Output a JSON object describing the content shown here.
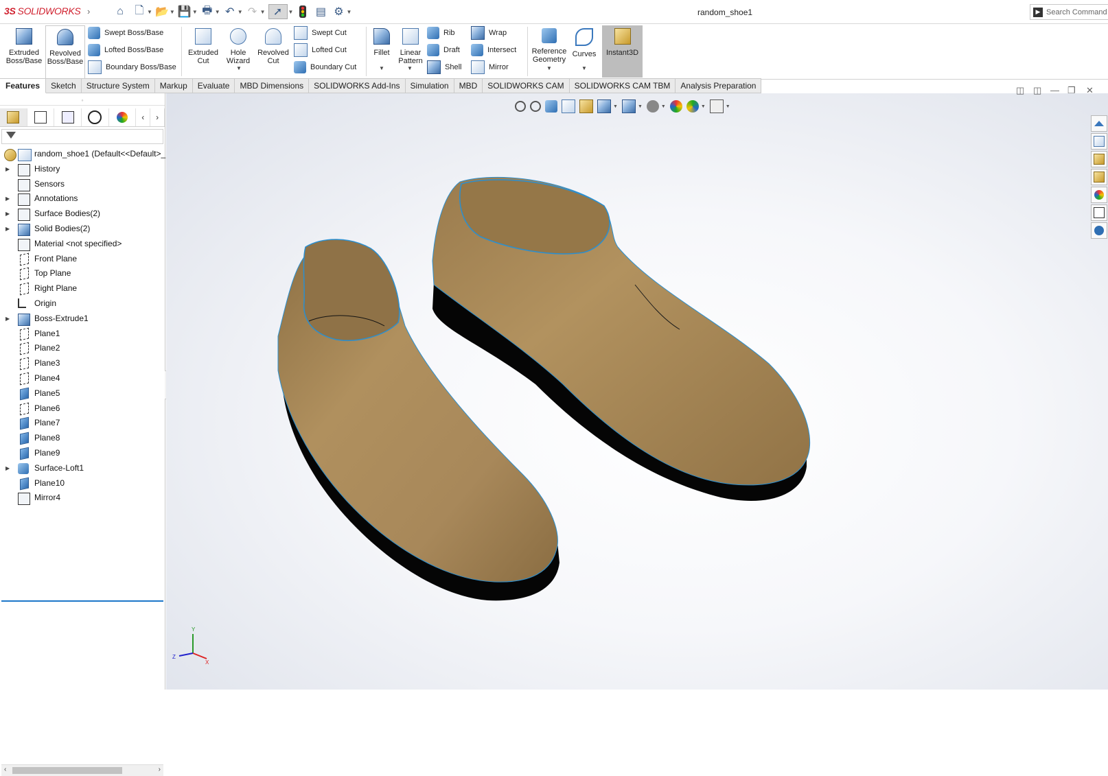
{
  "app": {
    "logo_ds": "3S",
    "logo_text": "SOLIDWORKS",
    "document_title": "random_shoe1",
    "search_placeholder": "Search Command"
  },
  "quick_access": [
    "home-icon",
    "new-document-icon",
    "open-icon",
    "save-icon",
    "print-icon",
    "undo-icon",
    "redo-icon",
    "select-icon",
    "rebuild-icon",
    "file-properties-icon",
    "options-icon"
  ],
  "ribbon": {
    "extruded_boss": "Extruded Boss/Base",
    "revolved_boss": "Revolved Boss/Base",
    "swept_boss": "Swept Boss/Base",
    "lofted_boss": "Lofted Boss/Base",
    "boundary_boss": "Boundary Boss/Base",
    "extruded_cut": "Extruded Cut",
    "hole_wizard": "Hole Wizard",
    "revolved_cut": "Revolved Cut",
    "swept_cut": "Swept Cut",
    "lofted_cut": "Lofted Cut",
    "boundary_cut": "Boundary Cut",
    "fillet": "Fillet",
    "linear_pattern": "Linear Pattern",
    "rib": "Rib",
    "draft": "Draft",
    "shell": "Shell",
    "wrap": "Wrap",
    "intersect": "Intersect",
    "mirror": "Mirror",
    "reference_geometry": "Reference Geometry",
    "curves": "Curves",
    "instant3d": "Instant3D"
  },
  "tabs": [
    "Features",
    "Sketch",
    "Structure System",
    "Markup",
    "Evaluate",
    "MBD Dimensions",
    "SOLIDWORKS Add-Ins",
    "Simulation",
    "MBD",
    "SOLIDWORKS CAM",
    "SOLIDWORKS CAM TBM",
    "Analysis Preparation"
  ],
  "tree": {
    "root": "random_shoe1  (Default<<Default>_",
    "items": [
      {
        "label": "History",
        "expandable": true,
        "icon": "history-icon"
      },
      {
        "label": "Sensors",
        "expandable": false,
        "icon": "sensors-icon"
      },
      {
        "label": "Annotations",
        "expandable": true,
        "icon": "annotations-icon"
      },
      {
        "label": "Surface Bodies(2)",
        "expandable": true,
        "icon": "surface-bodies-icon"
      },
      {
        "label": "Solid Bodies(2)",
        "expandable": true,
        "icon": "solid-bodies-icon"
      },
      {
        "label": "Material <not specified>",
        "expandable": false,
        "icon": "material-icon"
      },
      {
        "label": "Front Plane",
        "expandable": false,
        "icon": "plane-icon"
      },
      {
        "label": "Top Plane",
        "expandable": false,
        "icon": "plane-icon"
      },
      {
        "label": "Right Plane",
        "expandable": false,
        "icon": "plane-icon"
      },
      {
        "label": "Origin",
        "expandable": false,
        "icon": "origin-icon"
      },
      {
        "label": "Boss-Extrude1",
        "expandable": true,
        "icon": "boss-extrude-icon"
      },
      {
        "label": "Plane1",
        "expandable": false,
        "icon": "plane-icon"
      },
      {
        "label": "Plane2",
        "expandable": false,
        "icon": "plane-icon"
      },
      {
        "label": "Plane3",
        "expandable": false,
        "icon": "plane-icon"
      },
      {
        "label": "Plane4",
        "expandable": false,
        "icon": "plane-icon"
      },
      {
        "label": "Plane5",
        "expandable": false,
        "icon": "plane-filled-icon"
      },
      {
        "label": "Plane6",
        "expandable": false,
        "icon": "plane-icon"
      },
      {
        "label": "Plane7",
        "expandable": false,
        "icon": "plane-filled-icon"
      },
      {
        "label": "Plane8",
        "expandable": false,
        "icon": "plane-filled-icon"
      },
      {
        "label": "Plane9",
        "expandable": false,
        "icon": "plane-filled-icon"
      },
      {
        "label": "Surface-Loft1",
        "expandable": true,
        "icon": "surface-loft-icon"
      },
      {
        "label": "Plane10",
        "expandable": false,
        "icon": "plane-filled-icon"
      },
      {
        "label": "Mirror4",
        "expandable": false,
        "icon": "mirror-icon"
      }
    ]
  },
  "triad": {
    "x": "X",
    "y": "Y",
    "z": "Z"
  },
  "colors": {
    "shoe_upper": "#a8885a",
    "sole": "#050505",
    "edge": "#2a8fd0",
    "accent": "#1b76c9"
  }
}
